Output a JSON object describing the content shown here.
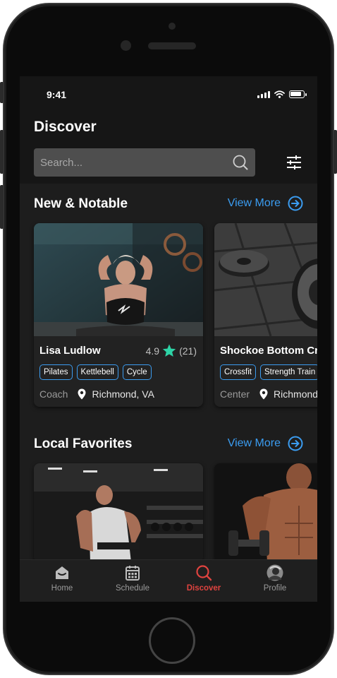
{
  "status": {
    "time": "9:41"
  },
  "header": {
    "title": "Discover"
  },
  "search": {
    "placeholder": "Search..."
  },
  "sections": [
    {
      "title": "New & Notable",
      "view_more": "View More",
      "cards": [
        {
          "name": "Lisa Ludlow",
          "rating": "4.9",
          "reviews": "(21)",
          "tags": [
            "Pilates",
            "Kettlebell",
            "Cycle"
          ],
          "type": "Coach",
          "location": "Richmond, VA"
        },
        {
          "name": "Shockoe Bottom Cr...",
          "tags": [
            "Crossfit",
            "Strength Train"
          ],
          "type": "Center",
          "location": "Richmond"
        }
      ]
    },
    {
      "title": "Local Favorites",
      "view_more": "View More"
    }
  ],
  "tabs": [
    {
      "label": "Home",
      "icon": "home-icon"
    },
    {
      "label": "Schedule",
      "icon": "calendar-icon"
    },
    {
      "label": "Discover",
      "icon": "search-icon",
      "active": true
    },
    {
      "label": "Profile",
      "icon": "avatar-icon"
    }
  ],
  "colors": {
    "accent": "#3b9cf0",
    "active_tab": "#e0433f",
    "star": "#2ed3a6"
  }
}
